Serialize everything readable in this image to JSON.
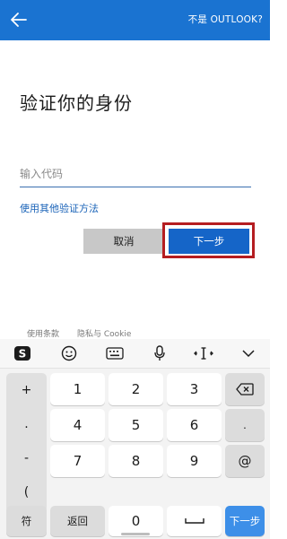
{
  "header": {
    "bg_color": "#1a73d1",
    "back_icon": "arrow-left-icon",
    "not_outlook_link": "不是 OUTLOOK?"
  },
  "main": {
    "title": "验证你的身份",
    "code_placeholder": "输入代码",
    "other_method_link": "使用其他验证方法",
    "cancel_button": "取消",
    "next_button": "下一步",
    "next_highlight_color": "#b51d21"
  },
  "footer": {
    "terms": "使用条款",
    "privacy": "隐私与 Cookie"
  },
  "keyboard": {
    "toolbar_icons": [
      "sogou-s-icon",
      "emoji-icon",
      "keyboard-icon",
      "microphone-icon",
      "text-cursor-icon",
      "chevron-down-icon"
    ],
    "symbols": [
      "+",
      ".",
      "-",
      "("
    ],
    "digits": [
      "1",
      "2",
      "3",
      "4",
      "5",
      "6",
      "7",
      "8",
      "9",
      "0"
    ],
    "right_keys": [
      "backspace",
      ".",
      "@"
    ],
    "bottom": {
      "symbol_key": "符",
      "back_key": "返回",
      "zero_key": "0",
      "next_key": "下一步"
    }
  }
}
